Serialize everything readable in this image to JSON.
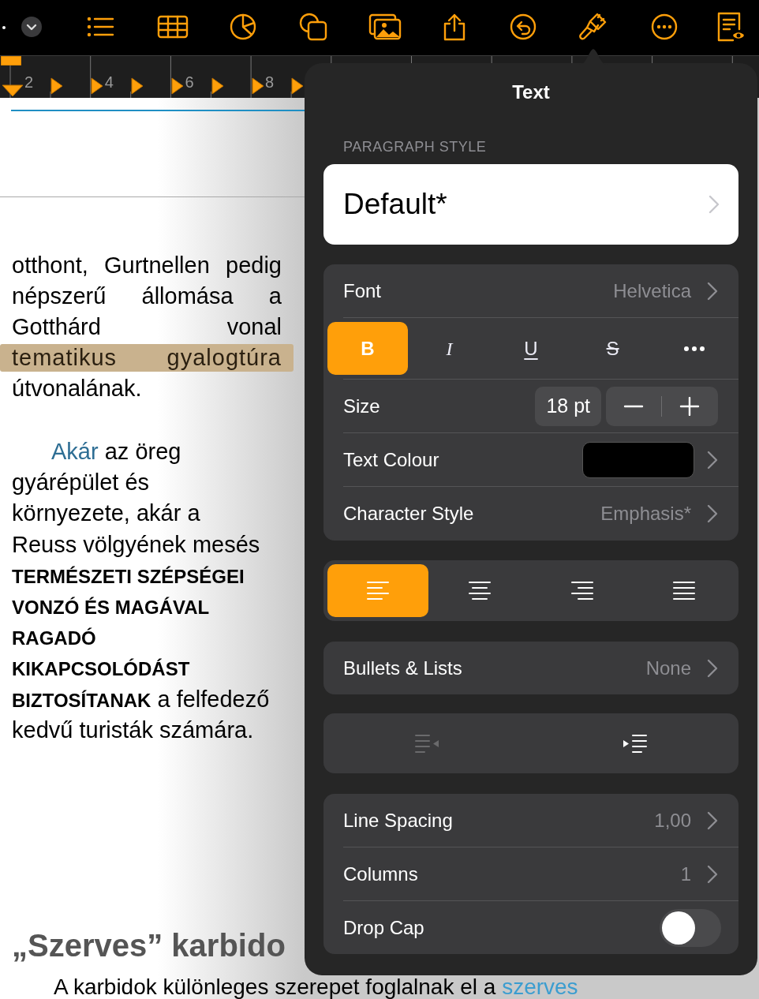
{
  "ruler": {
    "numbers": [
      "2",
      "4",
      "6",
      "8"
    ]
  },
  "document": {
    "paragraph_1": [
      {
        "text": "otthont, Gurtnellen pedig",
        "highlighted": false
      },
      {
        "text": "népszerű állomása a",
        "highlighted": false
      },
      {
        "text": "Gotthárd vonal",
        "highlighted": false
      },
      {
        "text": "tematikus gyalogtúra",
        "highlighted": true
      },
      {
        "text": "útvonalának.",
        "highlighted": false
      }
    ],
    "paragraph_2": [
      [
        {
          "kind": "link",
          "text": "Akár"
        },
        {
          "kind": "plain",
          "text": " az öreg"
        }
      ],
      [
        {
          "kind": "plain",
          "text": "gyárépület és"
        }
      ],
      [
        {
          "kind": "plain",
          "text": "környezete, akár a"
        }
      ],
      [
        {
          "kind": "plain",
          "text": "Reuss völgyének mesés"
        }
      ],
      [
        {
          "kind": "caps",
          "text": "TERMÉSZETI SZÉPSÉGEI"
        }
      ],
      [
        {
          "kind": "caps",
          "text": "VONZÓ ÉS MAGÁVAL"
        }
      ],
      [
        {
          "kind": "caps",
          "text": "RAGADÓ"
        }
      ],
      [
        {
          "kind": "caps",
          "text": "KIKAPCSOLÓDÁST"
        }
      ],
      [
        {
          "kind": "caps",
          "text": "BIZTOSÍTANAK"
        },
        {
          "kind": "plain",
          "text": " a felfedező"
        }
      ],
      [
        {
          "kind": "plain",
          "text": "kedvű turisták számára."
        }
      ]
    ],
    "heading": "„Szerves” karbido",
    "last_line": [
      {
        "kind": "plain",
        "text": "A karbidok különleges szerepet foglalnak el a "
      },
      {
        "kind": "link",
        "text": "szerves"
      }
    ]
  },
  "popover": {
    "title": "Text",
    "section_label": "PARAGRAPH STYLE",
    "paragraph_style": "Default*",
    "font": {
      "label": "Font",
      "value": "Helvetica"
    },
    "styles": [
      {
        "kind": "bold",
        "label": "B",
        "selected": true
      },
      {
        "kind": "italic",
        "label": "I",
        "selected": false
      },
      {
        "kind": "underline",
        "label": "U",
        "selected": false
      },
      {
        "kind": "strike",
        "label": "S",
        "selected": false
      },
      {
        "kind": "more",
        "selected": false
      }
    ],
    "size": {
      "label": "Size",
      "value": "18 pt"
    },
    "text_colour": {
      "label": "Text Colour",
      "color": "#000000"
    },
    "character_style": {
      "label": "Character Style",
      "value": "Emphasis*"
    },
    "alignment": [
      {
        "kind": "left",
        "selected": true
      },
      {
        "kind": "center",
        "selected": false
      },
      {
        "kind": "right",
        "selected": false
      },
      {
        "kind": "justify",
        "selected": false
      }
    ],
    "bullets": {
      "label": "Bullets & Lists",
      "value": "None"
    },
    "indent": [
      {
        "kind": "decrease",
        "disabled": true
      },
      {
        "kind": "increase",
        "disabled": false
      }
    ],
    "spacing": [
      {
        "kind": "value",
        "label": "Line Spacing",
        "value": "1,00"
      },
      {
        "kind": "value",
        "label": "Columns",
        "value": "1"
      },
      {
        "kind": "toggle",
        "label": "Drop Cap",
        "on": false
      }
    ]
  }
}
